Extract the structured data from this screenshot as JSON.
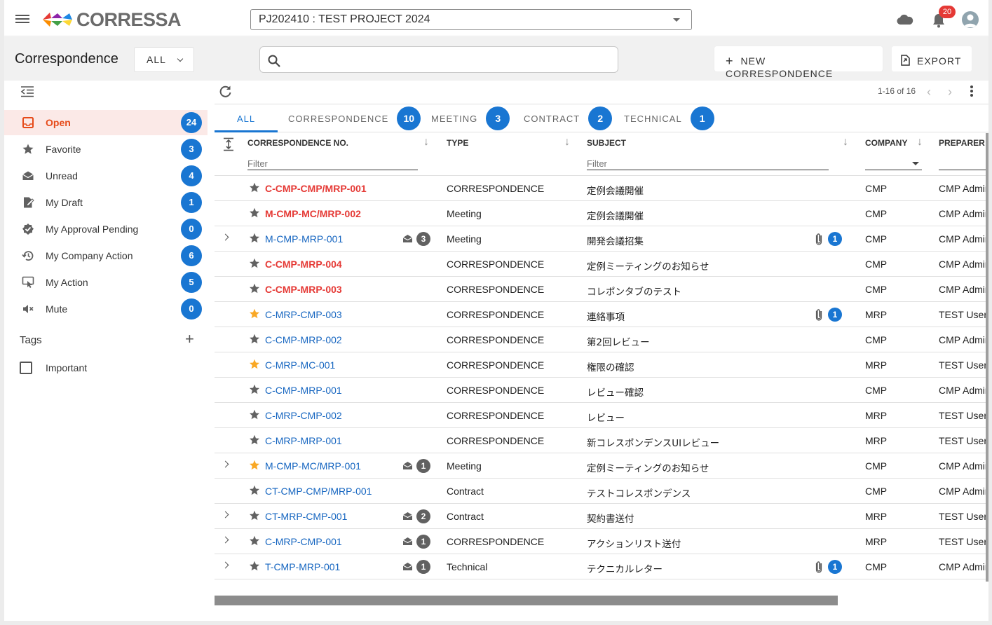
{
  "app": {
    "logo_text": "CORRESSA",
    "project": "PJ202410 : TEST PROJECT 2024",
    "notifications": "20"
  },
  "header": {
    "title": "Correspondence",
    "filter": "ALL",
    "search_value": "",
    "new_button": "NEW CORRESPONDENCE",
    "export_button": "EXPORT"
  },
  "sidebar": {
    "items": [
      {
        "label": "Open",
        "count": "24",
        "icon": "inbox-icon"
      },
      {
        "label": "Favorite",
        "count": "3",
        "icon": "star-icon"
      },
      {
        "label": "Unread",
        "count": "4",
        "icon": "mail-icon"
      },
      {
        "label": "My Draft",
        "count": "1",
        "icon": "draft-icon"
      },
      {
        "label": "My Approval Pending",
        "count": "0",
        "icon": "approval-icon"
      },
      {
        "label": "My Company Action",
        "count": "6",
        "icon": "history-icon"
      },
      {
        "label": "My Action",
        "count": "5",
        "icon": "touch-icon"
      },
      {
        "label": "Mute",
        "count": "0",
        "icon": "mute-icon"
      }
    ],
    "tags_title": "Tags",
    "tags": [
      {
        "label": "Important"
      }
    ]
  },
  "pager": {
    "text": "1-16 of 16"
  },
  "tabs": [
    {
      "label": "ALL",
      "count": ""
    },
    {
      "label": "CORRESPONDENCE",
      "count": "10"
    },
    {
      "label": "MEETING",
      "count": "3"
    },
    {
      "label": "CONTRACT",
      "count": "2"
    },
    {
      "label": "TECHNICAL",
      "count": "1"
    }
  ],
  "columns": {
    "cno": "CORRESPONDENCE NO.",
    "type": "TYPE",
    "subject": "SUBJECT",
    "company": "COMPANY",
    "preparer": "PREPARER",
    "filter_placeholder": "Filter"
  },
  "rows": [
    {
      "cno": "C-CMP-CMP/MRP-001",
      "unread": true,
      "fav": false,
      "expand": false,
      "mail": "",
      "type": "CORRESPONDENCE",
      "subject": "定例会議開催",
      "att": "",
      "company": "CMP",
      "preparer": "CMP Admin"
    },
    {
      "cno": "M-CMP-MC/MRP-002",
      "unread": true,
      "fav": false,
      "expand": false,
      "mail": "",
      "type": "Meeting",
      "subject": "定例会議開催",
      "att": "",
      "company": "CMP",
      "preparer": "CMP Admin"
    },
    {
      "cno": "M-CMP-MRP-001",
      "unread": false,
      "fav": false,
      "expand": true,
      "mail": "3",
      "type": "Meeting",
      "subject": "開発会議招集",
      "att": "1",
      "company": "CMP",
      "preparer": "CMP Admin"
    },
    {
      "cno": "C-CMP-MRP-004",
      "unread": true,
      "fav": false,
      "expand": false,
      "mail": "",
      "type": "CORRESPONDENCE",
      "subject": "定例ミーティングのお知らせ",
      "att": "",
      "company": "CMP",
      "preparer": "CMP Admin"
    },
    {
      "cno": "C-CMP-MRP-003",
      "unread": true,
      "fav": false,
      "expand": false,
      "mail": "",
      "type": "CORRESPONDENCE",
      "subject": "コレポンタブのテスト",
      "att": "",
      "company": "CMP",
      "preparer": "CMP Admin"
    },
    {
      "cno": "C-MRP-CMP-003",
      "unread": false,
      "fav": true,
      "expand": false,
      "mail": "",
      "type": "CORRESPONDENCE",
      "subject": "連絡事項",
      "att": "1",
      "company": "MRP",
      "preparer": "TEST User"
    },
    {
      "cno": "C-CMP-MRP-002",
      "unread": false,
      "fav": false,
      "expand": false,
      "mail": "",
      "type": "CORRESPONDENCE",
      "subject": "第2回レビュー",
      "att": "",
      "company": "CMP",
      "preparer": "CMP Admin"
    },
    {
      "cno": "C-MRP-MC-001",
      "unread": false,
      "fav": true,
      "expand": false,
      "mail": "",
      "type": "CORRESPONDENCE",
      "subject": "権限の確認",
      "att": "",
      "company": "MRP",
      "preparer": "TEST User"
    },
    {
      "cno": "C-CMP-MRP-001",
      "unread": false,
      "fav": false,
      "expand": false,
      "mail": "",
      "type": "CORRESPONDENCE",
      "subject": "レビュー確認",
      "att": "",
      "company": "CMP",
      "preparer": "CMP Admin"
    },
    {
      "cno": "C-MRP-CMP-002",
      "unread": false,
      "fav": false,
      "expand": false,
      "mail": "",
      "type": "CORRESPONDENCE",
      "subject": "レビュー",
      "att": "",
      "company": "MRP",
      "preparer": "TEST User"
    },
    {
      "cno": "C-MRP-MRP-001",
      "unread": false,
      "fav": false,
      "expand": false,
      "mail": "",
      "type": "CORRESPONDENCE",
      "subject": "新コレスポンデンスUIレビュー",
      "att": "",
      "company": "MRP",
      "preparer": "TEST User"
    },
    {
      "cno": "M-CMP-MC/MRP-001",
      "unread": false,
      "fav": true,
      "expand": true,
      "mail": "1",
      "type": "Meeting",
      "subject": "定例ミーティングのお知らせ",
      "att": "",
      "company": "CMP",
      "preparer": "CMP Admin"
    },
    {
      "cno": "CT-CMP-CMP/MRP-001",
      "unread": false,
      "fav": false,
      "expand": false,
      "mail": "",
      "type": "Contract",
      "subject": "テストコレスポンデンス",
      "att": "",
      "company": "CMP",
      "preparer": "CMP Admin"
    },
    {
      "cno": "CT-MRP-CMP-001",
      "unread": false,
      "fav": false,
      "expand": true,
      "mail": "2",
      "type": "Contract",
      "subject": "契約書送付",
      "att": "",
      "company": "MRP",
      "preparer": "TEST User"
    },
    {
      "cno": "C-MRP-CMP-001",
      "unread": false,
      "fav": false,
      "expand": true,
      "mail": "1",
      "type": "CORRESPONDENCE",
      "subject": "アクションリスト送付",
      "att": "",
      "company": "MRP",
      "preparer": "TEST User"
    },
    {
      "cno": "T-CMP-MRP-001",
      "unread": false,
      "fav": false,
      "expand": true,
      "mail": "1",
      "type": "Technical",
      "subject": "テクニカルレター",
      "att": "1",
      "company": "CMP",
      "preparer": "CMP Admin"
    }
  ],
  "colors": {
    "accent": "#1976d2",
    "unread": "#e53935",
    "favorite": "#f9a825",
    "star": "#616161",
    "active_bg": "#fbe9e7"
  }
}
